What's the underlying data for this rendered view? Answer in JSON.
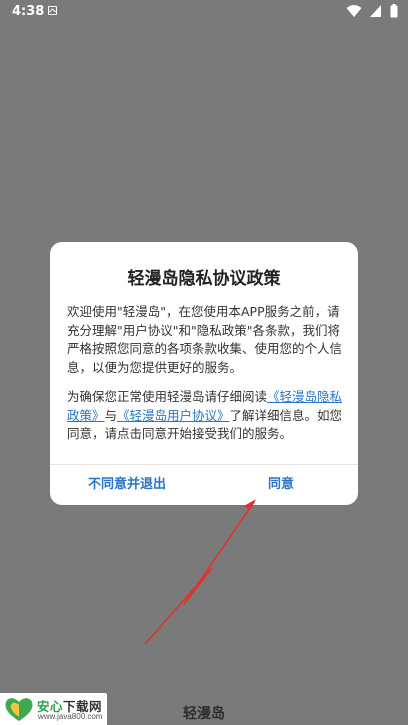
{
  "status_bar": {
    "time": "4:38",
    "notification_icon": "a-box-icon",
    "wifi_icon": "wifi-icon",
    "signal_icon": "signal-icon",
    "battery_icon": "battery-icon"
  },
  "dialog": {
    "title": "轻漫岛隐私协议政策",
    "paragraph1": "欢迎使用\"轻漫岛\"，在您使用本APP服务之前，请充分理解\"用户协议\"和\"隐私政策\"各条款，我们将严格按照您同意的各项条款收集、使用您的个人信息，以便为您提供更好的服务。",
    "paragraph2_prefix": "为确保您正常使用轻漫岛请仔细阅读",
    "privacy_link": "《轻漫岛隐私政策》",
    "and_text": "与",
    "user_agreement_link": "《轻漫岛用户协议》",
    "paragraph2_suffix": "了解详细信息。如您同意，请点击同意开始接受我们的服务。",
    "disagree_button": "不同意并退出",
    "agree_button": "同意"
  },
  "background": {
    "app_name": "轻漫岛"
  },
  "watermark": {
    "title_a": "安心",
    "title_b": "下载网",
    "url": "www.java800.com"
  },
  "colors": {
    "overlay": "#7a7a7a",
    "link": "#2a74c9",
    "arrow": "#e0322d"
  }
}
